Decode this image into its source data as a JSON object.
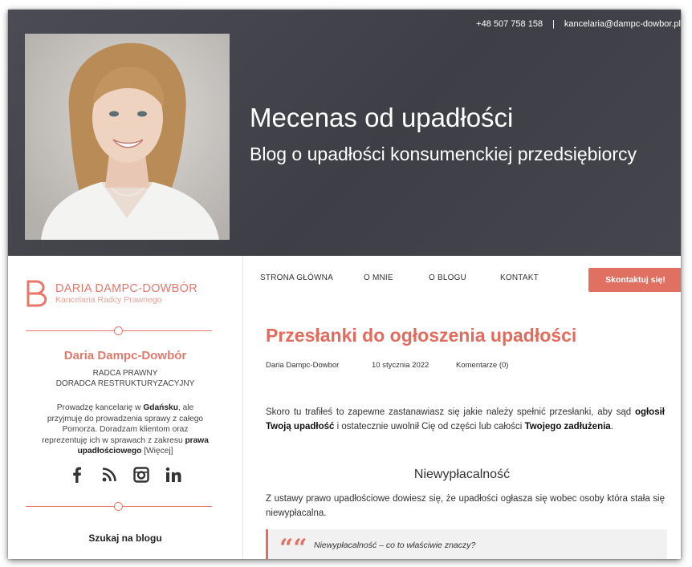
{
  "topbar": {
    "phone": "+48 507 758 158",
    "separator": "|",
    "email": "kancelaria@dampc-dowbor.pl"
  },
  "header": {
    "title": "Mecenas od upadłości",
    "subtitle": "Blog o upadłości konsumenckiej przedsiębiorcy",
    "portrait_icon": "portrait-photo"
  },
  "sidebar": {
    "brand_name": "DARIA DAMPC-DOWBÓR",
    "brand_sub": "Kancelaria Radcy Prawnego",
    "person_name": "Daria Dampc-Dowbór",
    "role_1": "RADCA PRAWNY",
    "role_2": "DORADCA RESTRUKTURYZACYJNY",
    "bio_1": "Prowadzę kancelarię w ",
    "bio_city": "Gdańsku",
    "bio_2": ", ale przyjmuję do prowadzenia sprawy z całego Pomorza. Doradzam klientom oraz reprezentuję ich w sprawach z zakresu ",
    "bio_law": "prawa upadłościowego",
    "bio_more": " [Więcej]",
    "social": [
      "facebook-icon",
      "rss-icon",
      "instagram-icon",
      "linkedin-icon"
    ],
    "search_label": "Szukaj na blogu"
  },
  "nav": {
    "items": [
      "STRONA GŁÓWNA",
      "O MNIE",
      "O BLOGU",
      "KONTAKT"
    ],
    "cta": "Skontaktuj się!"
  },
  "post": {
    "title": "Przesłanki do ogłoszenia upadłości",
    "author": "Daria Dampc-Dowbor",
    "date": "10 stycznia 2022",
    "comments": "Komentarze (0)",
    "p1_a": "Skoro tu trafiłeś to zapewne zastanawiasz się jakie należy spełnić przesłanki, aby sąd ",
    "p1_b": "ogłosił Twoją upadłość",
    "p1_c": " i ostatecznie uwolnił Cię od części lub całości ",
    "p1_d": "Twojego zadłużenia",
    "p1_e": ".",
    "heading": "Niewypłacalność",
    "p2": "Z ustawy prawo upadłościowe dowiesz się, że upadłości ogłasza się wobec osoby która stała się niewypłacalna.",
    "quote_mark": "““",
    "quote": "Niewypłacalność – co to właściwie znaczy?"
  },
  "colors": {
    "accent": "#e07062",
    "header_bg": "#45464d"
  }
}
